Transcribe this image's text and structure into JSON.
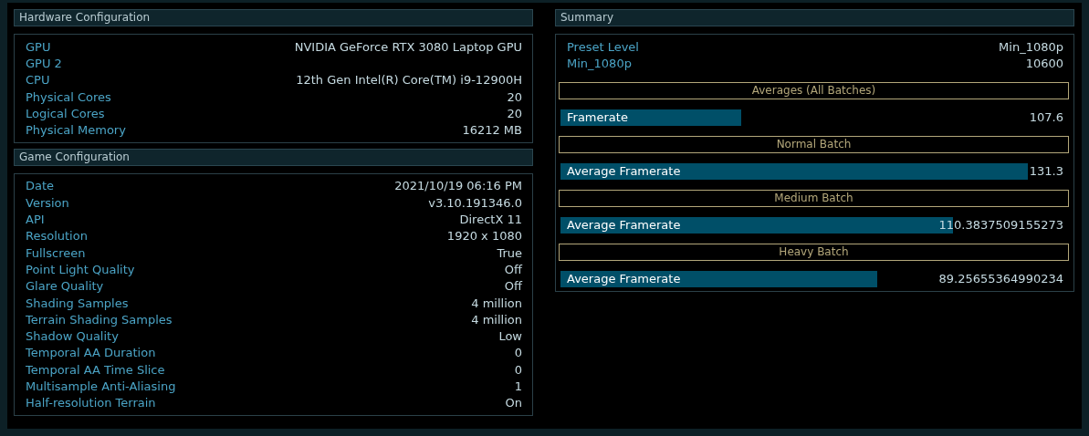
{
  "hardware": {
    "title": "Hardware Configuration",
    "rows": [
      {
        "label": "GPU",
        "value": "NVIDIA GeForce RTX 3080 Laptop GPU"
      },
      {
        "label": "GPU 2"
      },
      {
        "label": "CPU",
        "value": "12th Gen Intel(R) Core(TM) i9-12900H"
      },
      {
        "label": "Physical Cores",
        "value": "20"
      },
      {
        "label": "Logical Cores",
        "value": "20"
      },
      {
        "label": "Physical Memory",
        "value": "16212 MB"
      }
    ]
  },
  "game": {
    "title": "Game Configuration",
    "rows": [
      {
        "label": "Date",
        "value": "2021/10/19 06:16 PM"
      },
      {
        "label": "Version",
        "value": "v3.10.191346.0"
      },
      {
        "label": "API",
        "value": "DirectX 11"
      },
      {
        "label": "Resolution",
        "value": "1920 x 1080"
      },
      {
        "label": "Fullscreen",
        "value": "True"
      },
      {
        "label": "Point Light Quality",
        "value": "Off"
      },
      {
        "label": "Glare Quality",
        "value": "Off"
      },
      {
        "label": "Shading Samples",
        "value": "4 million"
      },
      {
        "label": "Terrain Shading Samples",
        "value": "4 million"
      },
      {
        "label": "Shadow Quality",
        "value": "Low"
      },
      {
        "label": "Temporal AA Duration",
        "value": "0"
      },
      {
        "label": "Temporal AA Time Slice",
        "value": "0"
      },
      {
        "label": "Multisample Anti-Aliasing",
        "value": "1"
      },
      {
        "label": "Half-resolution Terrain",
        "value": "On"
      }
    ]
  },
  "summary": {
    "title": "Summary",
    "rows": [
      {
        "label": "Preset Level",
        "value": "Min_1080p"
      },
      {
        "label": "Min_1080p",
        "value": "10600"
      }
    ],
    "batches": [
      {
        "heading": "Averages (All Batches)",
        "label": "Framerate",
        "value": "107.6",
        "level": 0.36
      },
      {
        "heading": "Normal Batch",
        "label": "Average Framerate",
        "value": "131.3",
        "level": 0.93
      },
      {
        "heading": "Medium Batch",
        "label": "Average Framerate",
        "value": "110.3837509155273",
        "level": 0.78
      },
      {
        "heading": "Heavy Batch",
        "label": "Average Framerate",
        "value": "89.25655364990234",
        "level": 0.63
      }
    ]
  }
}
